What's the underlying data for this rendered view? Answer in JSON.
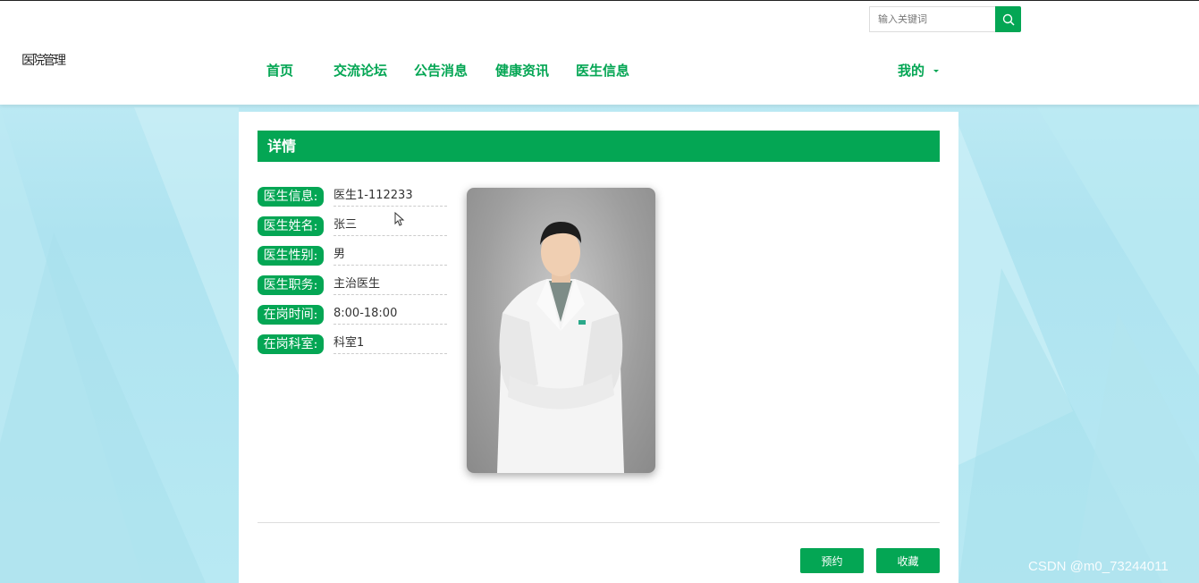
{
  "site": {
    "logo_text": "医院管理"
  },
  "search": {
    "placeholder": "输入关键词",
    "icon": "search-icon"
  },
  "nav": {
    "items": [
      {
        "label": "首页"
      },
      {
        "label": "交流论坛"
      },
      {
        "label": "公告消息"
      },
      {
        "label": "健康资讯"
      },
      {
        "label": "医生信息"
      }
    ],
    "mine_label": "我的"
  },
  "detail": {
    "title": "详情",
    "fields": [
      {
        "label": "医生信息:",
        "value": "医生1-112233"
      },
      {
        "label": "医生姓名:",
        "value": "张三"
      },
      {
        "label": "医生性别:",
        "value": "男"
      },
      {
        "label": "医生职务:",
        "value": "主治医生"
      },
      {
        "label": "在岗时间:",
        "value": "8:00-18:00"
      },
      {
        "label": "在岗科室:",
        "value": "科室1"
      }
    ]
  },
  "actions": {
    "book_label": "预约",
    "favorite_label": "收藏"
  },
  "watermark": "CSDN @m0_73244011",
  "colors": {
    "accent": "#04a654",
    "background": "#b8e9f3"
  }
}
